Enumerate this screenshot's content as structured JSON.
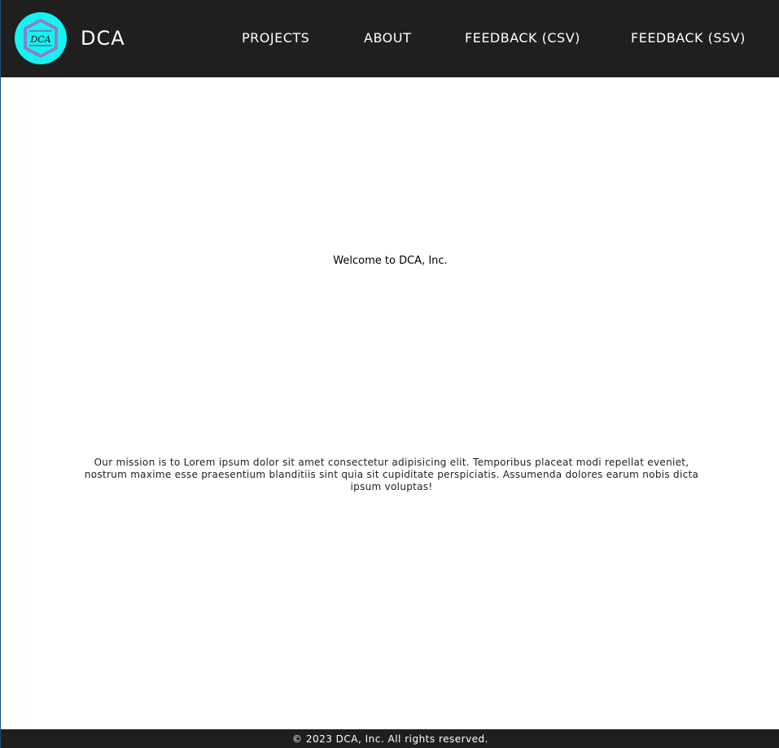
{
  "header": {
    "brand": "DCA",
    "logo_text": "DCA",
    "nav": [
      {
        "label": "PROJECTS"
      },
      {
        "label": "ABOUT"
      },
      {
        "label": "FEEDBACK (CSV)"
      },
      {
        "label": "FEEDBACK (SSV)"
      }
    ]
  },
  "main": {
    "welcome": "Welcome to DCA, Inc.",
    "mission": "Our mission is to Lorem ipsum dolor sit amet consectetur adipisicing elit. Temporibus placeat modi repellat eveniet, nostrum maxime esse praesentium blanditiis sint quia sit cupiditate perspiciatis. Assumenda dolores earum nobis dicta ipsum voluptas!"
  },
  "footer": {
    "text": "© 2023 DCA, Inc. All rights reserved."
  },
  "colors": {
    "header_bg": "#1f1f1f",
    "logo_bg": "#16f2f2",
    "logo_frame": "#8e7fc4",
    "text_light": "#ffffff"
  }
}
